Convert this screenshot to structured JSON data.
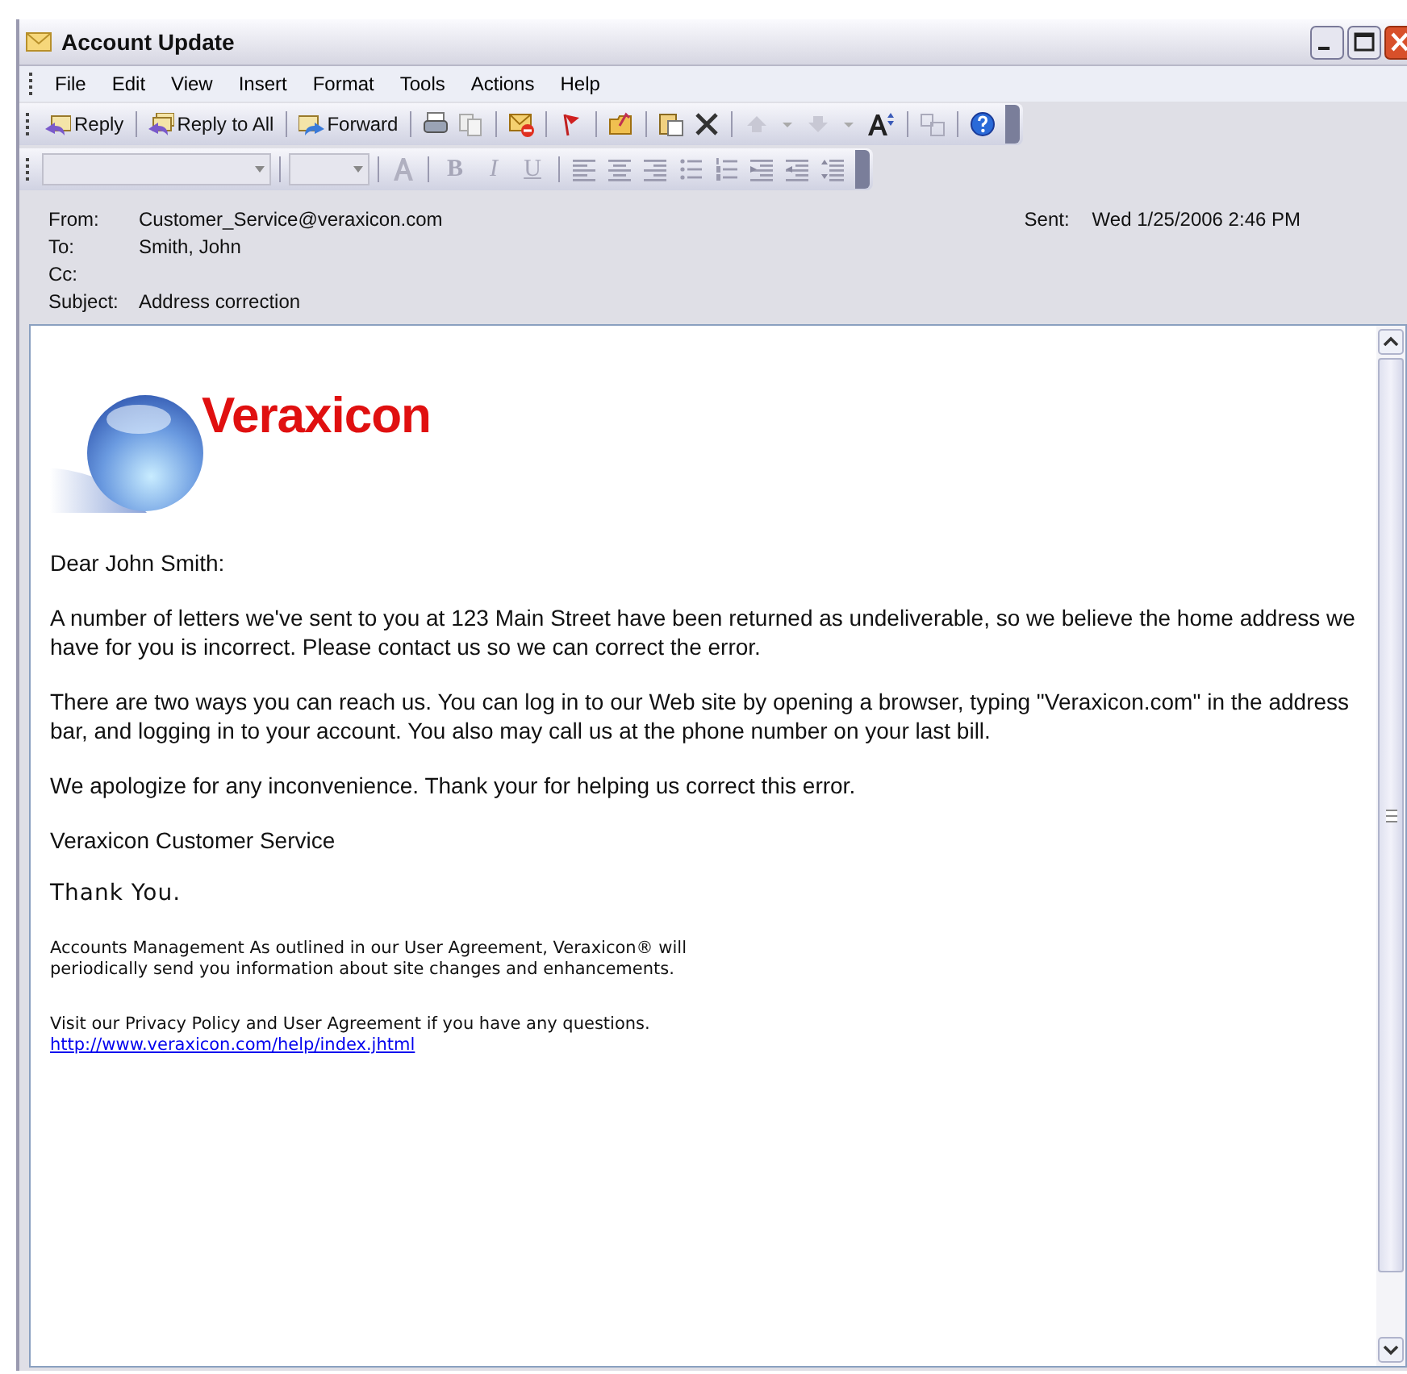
{
  "window": {
    "title": "Account Update"
  },
  "menu": [
    "File",
    "Edit",
    "View",
    "Insert",
    "Format",
    "Tools",
    "Actions",
    "Help"
  ],
  "toolbar": {
    "buttons": [
      {
        "label": "Reply"
      },
      {
        "label": "Reply to All"
      },
      {
        "label": "Forward"
      }
    ]
  },
  "format_toolbar": {
    "style_buttons": [
      {
        "label": "B",
        "disabled": true
      },
      {
        "label": "I",
        "disabled": true
      },
      {
        "label": "U",
        "disabled": true
      }
    ]
  },
  "header": {
    "fields": [
      {
        "label": "From:",
        "value": "Customer_Service@veraxicon.com"
      },
      {
        "label": "To:",
        "value": "Smith, John"
      },
      {
        "label": "Cc:"
      },
      {
        "label": "Subject:",
        "value": "Address correction"
      }
    ],
    "sent": {
      "label": "Sent:",
      "value": "Wed 1/25/2006 2:46 PM"
    }
  },
  "message": {
    "logo": "Veraxicon",
    "paragraphs": [
      {
        "kind": "text",
        "text": "Dear John Smith:"
      },
      {
        "kind": "text",
        "text": "A number of letters we've sent to you at 123 Main Street have been returned as undeliverable, so we believe the home address we have for you is incorrect. Please contact us so we can correct the error."
      },
      {
        "kind": "text",
        "text": "There are two ways you can reach us. You can log in to our Web site by opening a browser, typing \"Veraxicon.com\" in the address bar, and logging in to your account. You also may call us at the phone number on your last bill."
      },
      {
        "kind": "text",
        "text": "We apologize for any inconvenience. Thank your for helping us correct this error."
      },
      {
        "kind": "text",
        "text": "Veraxicon Customer Service"
      },
      {
        "kind": "closing",
        "text": "Thank You."
      },
      {
        "kind": "fine",
        "text": "Accounts Management As outlined in our User Agreement, Veraxicon® will periodically send you information about site changes and enhancements."
      },
      {
        "kind": "fine",
        "text": "Visit our Privacy Policy and User Agreement if you have any questions.",
        "link": "http://www.veraxicon.com/help/index.jhtml"
      }
    ]
  }
}
